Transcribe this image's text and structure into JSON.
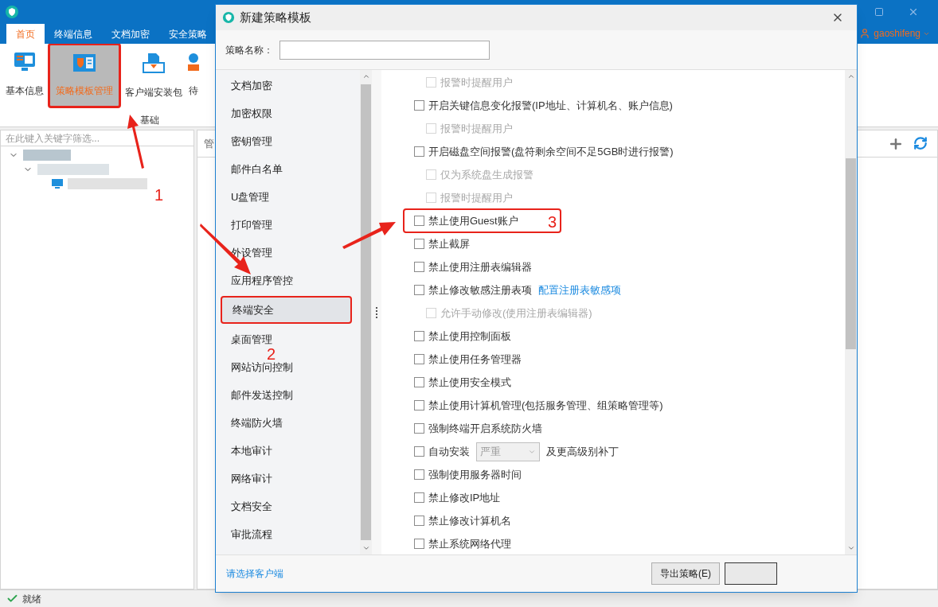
{
  "app": {
    "menu_tabs": [
      {
        "label": "首页",
        "selected": true
      },
      {
        "label": "终端信息",
        "selected": false
      },
      {
        "label": "文档加密",
        "selected": false
      },
      {
        "label": "安全策略",
        "selected": false
      }
    ],
    "user": "gaoshifeng",
    "ribbon": {
      "buttons": [
        {
          "label": "基本信息",
          "selected": false,
          "highlighted": false
        },
        {
          "label": "策略模板管理",
          "selected": true,
          "highlighted": true
        },
        {
          "label": "客户端安装包",
          "selected": false,
          "highlighted": false
        },
        {
          "label": "待",
          "selected": false,
          "highlighted": false
        }
      ],
      "group": "基础"
    },
    "filter": {
      "placeholder": "在此键入关键字筛选..."
    },
    "panel_header": "管",
    "status": "就绪"
  },
  "dialog": {
    "title": "新建策略模板",
    "name_label": "策略名称：",
    "nav": [
      {
        "label": "文档加密",
        "selected": false,
        "highlighted": false
      },
      {
        "label": "加密权限",
        "selected": false,
        "highlighted": false
      },
      {
        "label": "密钥管理",
        "selected": false,
        "highlighted": false
      },
      {
        "label": "邮件白名单",
        "selected": false,
        "highlighted": false
      },
      {
        "label": "U盘管理",
        "selected": false,
        "highlighted": false
      },
      {
        "label": "打印管理",
        "selected": false,
        "highlighted": false
      },
      {
        "label": "外设管理",
        "selected": false,
        "highlighted": false
      },
      {
        "label": "应用程序管控",
        "selected": false,
        "highlighted": false
      },
      {
        "label": "终端安全",
        "selected": true,
        "highlighted": true
      },
      {
        "label": "桌面管理",
        "selected": false,
        "highlighted": false
      },
      {
        "label": "网站访问控制",
        "selected": false,
        "highlighted": false
      },
      {
        "label": "邮件发送控制",
        "selected": false,
        "highlighted": false
      },
      {
        "label": "终端防火墙",
        "selected": false,
        "highlighted": false
      },
      {
        "label": "本地审计",
        "selected": false,
        "highlighted": false
      },
      {
        "label": "网络审计",
        "selected": false,
        "highlighted": false
      },
      {
        "label": "文档安全",
        "selected": false,
        "highlighted": false
      },
      {
        "label": "审批流程",
        "selected": false,
        "highlighted": false
      }
    ],
    "options": [
      {
        "kind": "sub-option",
        "label": "报警时提醒用户",
        "checked": false,
        "disabled": true
      },
      {
        "kind": "option",
        "label": "开启关键信息变化报警(IP地址、计算机名、账户信息)",
        "checked": false,
        "disabled": false,
        "children": [
          {
            "label": "报警时提醒用户",
            "checked": false,
            "disabled": true
          }
        ]
      },
      {
        "kind": "option",
        "label": "开启磁盘空间报警(盘符剩余空间不足5GB时进行报警)",
        "checked": false,
        "disabled": false,
        "children": [
          {
            "label": "仅为系统盘生成报警",
            "checked": false,
            "disabled": true
          },
          {
            "label": "报警时提醒用户",
            "checked": false,
            "disabled": true
          }
        ]
      },
      {
        "kind": "option",
        "label": "禁止使用Guest账户",
        "checked": false,
        "disabled": false,
        "highlighted": true
      },
      {
        "kind": "option",
        "label": "禁止截屏",
        "checked": false,
        "disabled": false
      },
      {
        "kind": "option",
        "label": "禁止使用注册表编辑器",
        "checked": false,
        "disabled": false
      },
      {
        "kind": "link-option",
        "label": "禁止修改敏感注册表项",
        "link": "配置注册表敏感项",
        "checked": false,
        "disabled": false,
        "children": [
          {
            "label": "允许手动修改(使用注册表编辑器)",
            "checked": false,
            "disabled": true
          }
        ]
      },
      {
        "kind": "option",
        "label": "禁止使用控制面板",
        "checked": false,
        "disabled": false
      },
      {
        "kind": "option",
        "label": "禁止使用任务管理器",
        "checked": false,
        "disabled": false
      },
      {
        "kind": "option",
        "label": "禁止使用安全模式",
        "checked": false,
        "disabled": false
      },
      {
        "kind": "option",
        "label": "禁止使用计算机管理(包括服务管理、组策略管理等)",
        "checked": false,
        "disabled": false
      },
      {
        "kind": "option",
        "label": "强制终端开启系统防火墙",
        "checked": false,
        "disabled": false
      },
      {
        "kind": "select-option",
        "label": "自动安装",
        "select": "严重",
        "suffix": "及更高级别补丁",
        "checked": false,
        "disabled": false
      },
      {
        "kind": "option",
        "label": "强制使用服务器时间",
        "checked": false,
        "disabled": false
      },
      {
        "kind": "option",
        "label": "禁止修改IP地址",
        "checked": false,
        "disabled": false
      },
      {
        "kind": "option",
        "label": "禁止修改计算机名",
        "checked": false,
        "disabled": false
      },
      {
        "kind": "option",
        "label": "禁止系统网络代理",
        "checked": false,
        "disabled": false
      }
    ],
    "client_link": "请选择客户端",
    "buttons": [
      "导出策略(E)"
    ]
  },
  "annotations": [
    {
      "label": "1"
    },
    {
      "label": "2"
    },
    {
      "label": "3"
    }
  ]
}
